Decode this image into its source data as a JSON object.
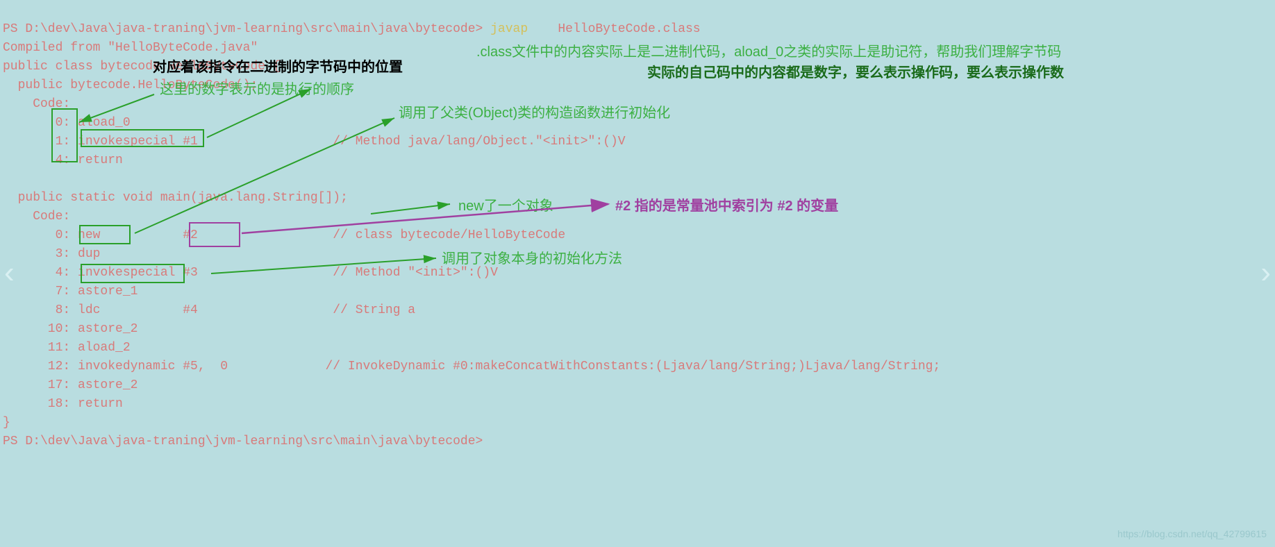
{
  "terminal": {
    "prompt1_path": "PS D:\\dev\\Java\\java-traning\\jvm-learning\\src\\main\\java\\bytecode>",
    "cmd": "javap",
    "cmd_arg": "HelloByteCode.class",
    "compiled_from": "Compiled from \"HelloByteCode.java\"",
    "class_decl": "public class bytecode.HelloByteCode {",
    "ctor_sig": "  public bytecode.HelloByteCode();",
    "code_label1": "    Code:",
    "inst_0": "       0: aload_0",
    "inst_1": "       1: invokespecial #1",
    "inst_1_comment": "                  // Method java/lang/Object.\"<init>\":()V",
    "inst_4a": "       4: return",
    "blank": "",
    "main_sig": "  public static void main(java.lang.String[]);",
    "code_label2": "    Code:",
    "m_0": "       0: new           #2",
    "m_0_comment": "                  // class bytecode/HelloByteCode",
    "m_3": "       3: dup",
    "m_4": "       4: invokespecial #3",
    "m_4_comment": "                  // Method \"<init>\":()V",
    "m_7": "       7: astore_1",
    "m_8": "       8: ldc           #4",
    "m_8_comment": "                  // String a",
    "m_10": "      10: astore_2",
    "m_11": "      11: aload_2",
    "m_12": "      12: invokedynamic #5,  0",
    "m_12_comment": "             // InvokeDynamic #0:makeConcatWithConstants:(Ljava/lang/String;)Ljava/lang/String;",
    "m_17": "      17: astore_2",
    "m_18": "      18: return",
    "close_brace": "}",
    "prompt2": "PS D:\\dev\\Java\\java-traning\\jvm-learning\\src\\main\\java\\bytecode>"
  },
  "annotations": {
    "black_title": "对应着该指令在二进制的字节码中的位置",
    "green_order": "这里的数字表示的是执行的顺序",
    "green_class_note": ".class文件中的内容实际上是二进制代码，aload_0之类的实际上是助记符，帮助我们理解字节码",
    "green_bold_note": "实际的自己码中的内容都是数字，要么表示操作码，要么表示操作数",
    "green_parent_ctor": "调用了父类(Object)类的构造函数进行初始化",
    "green_new_obj": "new了一个对象",
    "purple_ref2": "#2 指的是常量池中索引为 #2 的变量",
    "green_self_init": "调用了对象本身的初始化方法"
  },
  "watermark": "https://blog.csdn.net/qq_42799615",
  "nav": {
    "left": "‹",
    "right": "›"
  }
}
